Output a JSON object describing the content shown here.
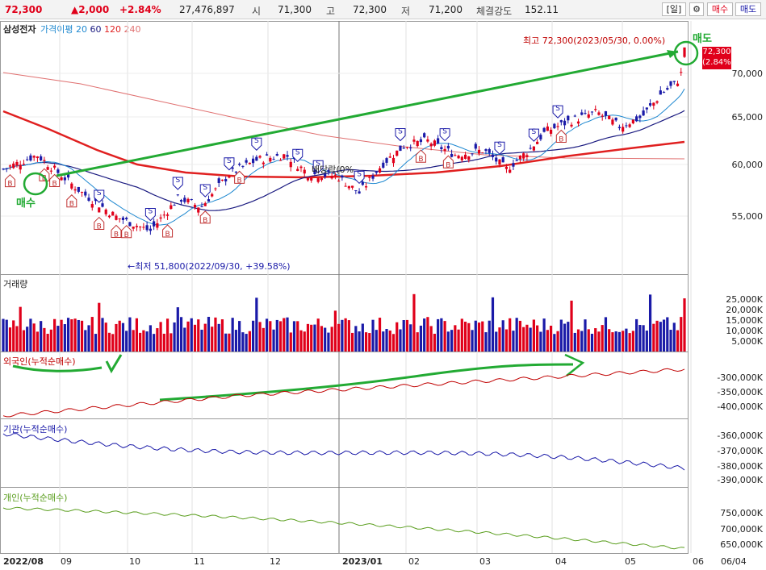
{
  "header": {
    "price": "72,300",
    "change": "▲2,000",
    "change_pct": "+2.84%",
    "volume": "27,476,897",
    "open_label": "시",
    "open_value": "71,300",
    "high_label": "고",
    "high_value": "72,300",
    "low_label": "저",
    "low_value": "71,200",
    "strength_label": "체결강도",
    "strength_value": "152.11",
    "period_button": "[일]",
    "buy_button": "매수",
    "sell_button": "매도"
  },
  "legend": {
    "stock_name": "삼성전자",
    "indicator": "가격이평",
    "ma20": "20",
    "ma60": "60",
    "ma120": "120",
    "ma240": "240"
  },
  "price_pane": {
    "y_ticks": [
      "70,000",
      "65,000",
      "60,000",
      "55,000"
    ],
    "current_price": "72,300",
    "current_pct": "(2.84%)",
    "high_annotation": "최고 72,300(2023/05/30, 0.00%)",
    "low_annotation": "←최저 51,800(2022/09/30, +39.58%)",
    "dividend_annotation": "배당락(0%",
    "buy_text": "매수",
    "sell_text": "매도",
    "buy_marker": "B",
    "sell_marker": "S"
  },
  "volume_pane": {
    "title": "거래량",
    "y_ticks": [
      "25,000K",
      "20,000K",
      "15,000K",
      "10,000K",
      "5,000K"
    ]
  },
  "foreign_pane": {
    "title": "외국인(누적순매수)",
    "y_ticks": [
      "-300,000K",
      "-350,000K",
      "-400,000K"
    ]
  },
  "institution_pane": {
    "title": "기관(누적순매수)",
    "y_ticks": [
      "-360,000K",
      "-370,000K",
      "-380,000K",
      "-390,000K"
    ]
  },
  "individual_pane": {
    "title": "개인(누적순매수)",
    "y_ticks": [
      "750,000K",
      "700,000K",
      "650,000K"
    ]
  },
  "x_axis": {
    "labels": [
      "2022/08",
      "09",
      "10",
      "11",
      "12",
      "2023/01",
      "02",
      "03",
      "04",
      "05",
      "06"
    ],
    "last_date": "06/04"
  },
  "colors": {
    "up": "#e0001a",
    "down": "#1a1aa8",
    "ma20": "#1e88d0",
    "ma60": "#1a1a80",
    "ma120": "#e02020",
    "ma240": "#e07070",
    "annotation": "#22aa33"
  }
}
